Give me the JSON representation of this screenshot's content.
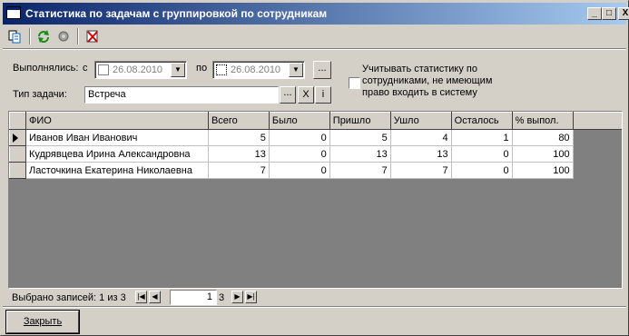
{
  "window": {
    "title": "Статистика по задачам с группировкой по сотрудникам",
    "minimize": "_",
    "maximize": "□",
    "close": "X"
  },
  "toolbar": {
    "icons": [
      "copy-icon",
      "refresh-icon",
      "settings-icon",
      "clear-filter-icon"
    ]
  },
  "filter": {
    "executed_label": "Выполнялись:",
    "from_label": "с",
    "from_value": "26.08.2010",
    "to_label": "по",
    "to_value": "26.08.2010",
    "ellipsis": "...",
    "task_type_label": "Тип задачи:",
    "task_type_value": "Встреча",
    "clear_btn": "X",
    "info_btn": "i",
    "checkbox_label_1": "Учитывать статистику по",
    "checkbox_label_2": "сотрудниками, не имеющим",
    "checkbox_label_3": "право входить в систему"
  },
  "table": {
    "columns": [
      "ФИО",
      "Всего",
      "Было",
      "Пришло",
      "Ушло",
      "Осталось",
      "% выпол."
    ],
    "rows": [
      {
        "name": "Иванов Иван Иванович",
        "total": "5",
        "was": "0",
        "came": "5",
        "left": "4",
        "remain": "1",
        "pct": "80"
      },
      {
        "name": "Кудрявцева Ирина Александровна",
        "total": "13",
        "was": "0",
        "came": "13",
        "left": "13",
        "remain": "0",
        "pct": "100"
      },
      {
        "name": "Ласточкина Екатерина Николаевна",
        "total": "7",
        "was": "0",
        "came": "7",
        "left": "7",
        "remain": "0",
        "pct": "100"
      }
    ]
  },
  "status": {
    "selected": "Выбрано записей: 1 из 3",
    "page": "1",
    "total": "3"
  },
  "close_button": "Закрыть",
  "colors": {
    "title_start": "#0a246a",
    "title_end": "#a6caf0",
    "face": "#d4d0c8"
  }
}
